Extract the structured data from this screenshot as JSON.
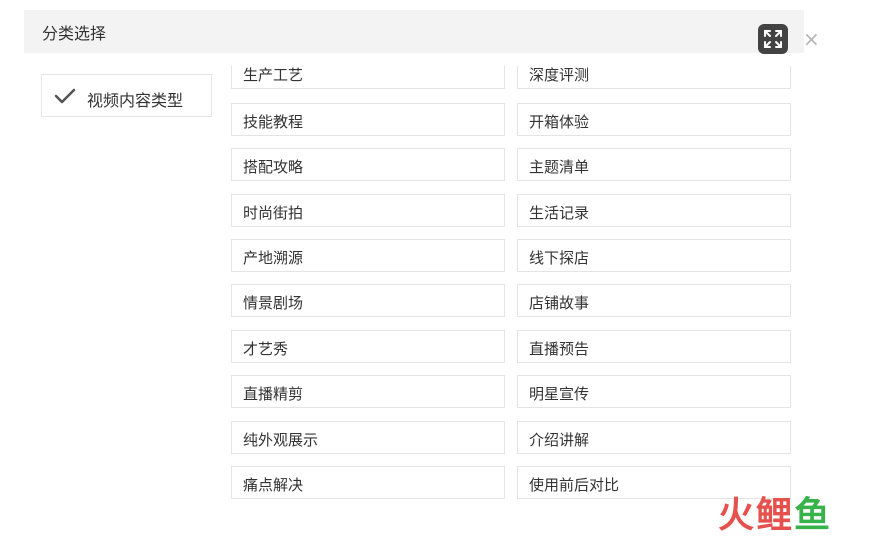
{
  "dialog": {
    "title": "分类选择",
    "close_symbol": "×"
  },
  "sidebar": {
    "items": [
      {
        "label": "视频内容类型",
        "selected": true
      }
    ]
  },
  "categories": {
    "left": [
      "生产工艺",
      "技能教程",
      "搭配攻略",
      "时尚街拍",
      "产地溯源",
      "情景剧场",
      "才艺秀",
      "直播精剪",
      "纯外观展示",
      "痛点解决"
    ],
    "right": [
      "深度评测",
      "开箱体验",
      "主题清单",
      "生活记录",
      "线下探店",
      "店铺故事",
      "直播预告",
      "明星宣传",
      "介绍讲解",
      "使用前后对比"
    ]
  },
  "watermark": {
    "c1": "火",
    "c2": "鲤",
    "c3": "鱼"
  },
  "colors": {
    "header_bg": "#f3f3f3",
    "border": "#e4e4e4",
    "text": "#333333"
  },
  "icons": {
    "check": "check-icon",
    "close": "close-icon",
    "expand": "expand-icon"
  }
}
